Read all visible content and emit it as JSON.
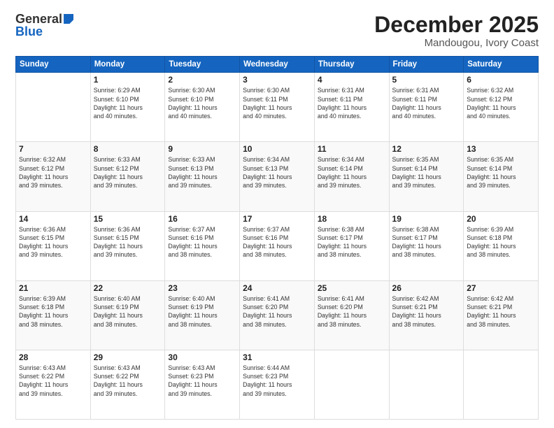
{
  "logo": {
    "general": "General",
    "blue": "Blue"
  },
  "title": {
    "month": "December 2025",
    "location": "Mandougou, Ivory Coast"
  },
  "header": {
    "days": [
      "Sunday",
      "Monday",
      "Tuesday",
      "Wednesday",
      "Thursday",
      "Friday",
      "Saturday"
    ]
  },
  "weeks": [
    [
      {
        "day": "",
        "info": ""
      },
      {
        "day": "1",
        "info": "Sunrise: 6:29 AM\nSunset: 6:10 PM\nDaylight: 11 hours\nand 40 minutes."
      },
      {
        "day": "2",
        "info": "Sunrise: 6:30 AM\nSunset: 6:10 PM\nDaylight: 11 hours\nand 40 minutes."
      },
      {
        "day": "3",
        "info": "Sunrise: 6:30 AM\nSunset: 6:11 PM\nDaylight: 11 hours\nand 40 minutes."
      },
      {
        "day": "4",
        "info": "Sunrise: 6:31 AM\nSunset: 6:11 PM\nDaylight: 11 hours\nand 40 minutes."
      },
      {
        "day": "5",
        "info": "Sunrise: 6:31 AM\nSunset: 6:11 PM\nDaylight: 11 hours\nand 40 minutes."
      },
      {
        "day": "6",
        "info": "Sunrise: 6:32 AM\nSunset: 6:12 PM\nDaylight: 11 hours\nand 40 minutes."
      }
    ],
    [
      {
        "day": "7",
        "info": "Sunrise: 6:32 AM\nSunset: 6:12 PM\nDaylight: 11 hours\nand 39 minutes."
      },
      {
        "day": "8",
        "info": "Sunrise: 6:33 AM\nSunset: 6:12 PM\nDaylight: 11 hours\nand 39 minutes."
      },
      {
        "day": "9",
        "info": "Sunrise: 6:33 AM\nSunset: 6:13 PM\nDaylight: 11 hours\nand 39 minutes."
      },
      {
        "day": "10",
        "info": "Sunrise: 6:34 AM\nSunset: 6:13 PM\nDaylight: 11 hours\nand 39 minutes."
      },
      {
        "day": "11",
        "info": "Sunrise: 6:34 AM\nSunset: 6:14 PM\nDaylight: 11 hours\nand 39 minutes."
      },
      {
        "day": "12",
        "info": "Sunrise: 6:35 AM\nSunset: 6:14 PM\nDaylight: 11 hours\nand 39 minutes."
      },
      {
        "day": "13",
        "info": "Sunrise: 6:35 AM\nSunset: 6:14 PM\nDaylight: 11 hours\nand 39 minutes."
      }
    ],
    [
      {
        "day": "14",
        "info": "Sunrise: 6:36 AM\nSunset: 6:15 PM\nDaylight: 11 hours\nand 39 minutes."
      },
      {
        "day": "15",
        "info": "Sunrise: 6:36 AM\nSunset: 6:15 PM\nDaylight: 11 hours\nand 39 minutes."
      },
      {
        "day": "16",
        "info": "Sunrise: 6:37 AM\nSunset: 6:16 PM\nDaylight: 11 hours\nand 38 minutes."
      },
      {
        "day": "17",
        "info": "Sunrise: 6:37 AM\nSunset: 6:16 PM\nDaylight: 11 hours\nand 38 minutes."
      },
      {
        "day": "18",
        "info": "Sunrise: 6:38 AM\nSunset: 6:17 PM\nDaylight: 11 hours\nand 38 minutes."
      },
      {
        "day": "19",
        "info": "Sunrise: 6:38 AM\nSunset: 6:17 PM\nDaylight: 11 hours\nand 38 minutes."
      },
      {
        "day": "20",
        "info": "Sunrise: 6:39 AM\nSunset: 6:18 PM\nDaylight: 11 hours\nand 38 minutes."
      }
    ],
    [
      {
        "day": "21",
        "info": "Sunrise: 6:39 AM\nSunset: 6:18 PM\nDaylight: 11 hours\nand 38 minutes."
      },
      {
        "day": "22",
        "info": "Sunrise: 6:40 AM\nSunset: 6:19 PM\nDaylight: 11 hours\nand 38 minutes."
      },
      {
        "day": "23",
        "info": "Sunrise: 6:40 AM\nSunset: 6:19 PM\nDaylight: 11 hours\nand 38 minutes."
      },
      {
        "day": "24",
        "info": "Sunrise: 6:41 AM\nSunset: 6:20 PM\nDaylight: 11 hours\nand 38 minutes."
      },
      {
        "day": "25",
        "info": "Sunrise: 6:41 AM\nSunset: 6:20 PM\nDaylight: 11 hours\nand 38 minutes."
      },
      {
        "day": "26",
        "info": "Sunrise: 6:42 AM\nSunset: 6:21 PM\nDaylight: 11 hours\nand 38 minutes."
      },
      {
        "day": "27",
        "info": "Sunrise: 6:42 AM\nSunset: 6:21 PM\nDaylight: 11 hours\nand 38 minutes."
      }
    ],
    [
      {
        "day": "28",
        "info": "Sunrise: 6:43 AM\nSunset: 6:22 PM\nDaylight: 11 hours\nand 39 minutes."
      },
      {
        "day": "29",
        "info": "Sunrise: 6:43 AM\nSunset: 6:22 PM\nDaylight: 11 hours\nand 39 minutes."
      },
      {
        "day": "30",
        "info": "Sunrise: 6:43 AM\nSunset: 6:23 PM\nDaylight: 11 hours\nand 39 minutes."
      },
      {
        "day": "31",
        "info": "Sunrise: 6:44 AM\nSunset: 6:23 PM\nDaylight: 11 hours\nand 39 minutes."
      },
      {
        "day": "",
        "info": ""
      },
      {
        "day": "",
        "info": ""
      },
      {
        "day": "",
        "info": ""
      }
    ]
  ]
}
